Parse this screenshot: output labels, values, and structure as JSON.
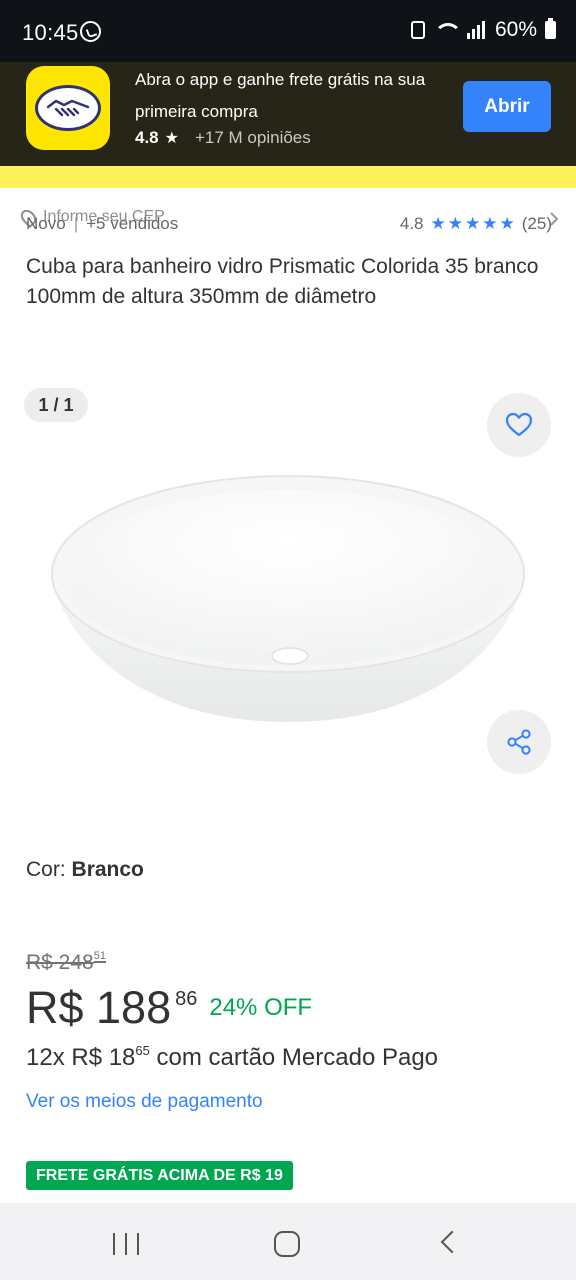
{
  "status_bar": {
    "time": "10:45",
    "battery": "60%"
  },
  "header": {
    "cep_placeholder": "Informe seu CEP"
  },
  "app_banner": {
    "message": "Abra o app e ganhe frete grátis na sua primeira compra",
    "rating": "4.8",
    "reviews": "+17 M opiniões",
    "open_label": "Abrir"
  },
  "product": {
    "condition": "Novo",
    "sold": "+5 vendidos",
    "rating": "4.8",
    "rating_stars": 4.8,
    "review_count": "(25)",
    "title": "Cuba para banheiro vidro Prismatic Colorida 35 branco 100mm de altura 350mm de diâmetro"
  },
  "gallery": {
    "counter": "1 / 1"
  },
  "color": {
    "label": "Cor:",
    "value": "Branco"
  },
  "pricing": {
    "old_price": "R$ 248",
    "old_cents": "51",
    "price": "R$ 188",
    "price_cents": "86",
    "discount": "24% OFF",
    "installments_prefix": "12x R$ 18",
    "installments_cents": "65",
    "installments_suffix": "com cartão Mercado Pago",
    "payment_link": "Ver os meios de pagamento",
    "shipping_badge": "FRETE GRÁTIS ACIMA DE R$ 19"
  },
  "colors": {
    "ml_yellow": "#fff159",
    "accent_blue": "#3483fa",
    "discount_green": "#00a650"
  }
}
